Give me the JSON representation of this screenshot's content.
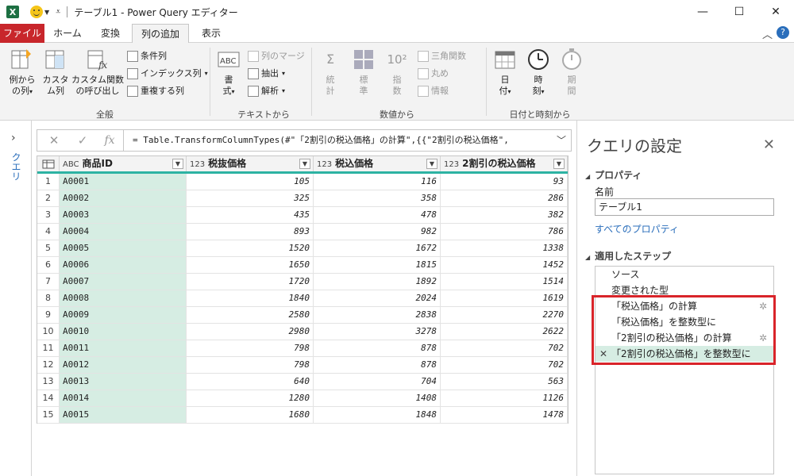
{
  "titlebar": {
    "app_icon": "X",
    "title": "テーブル1 - Power Query エディター",
    "minimize": "—",
    "maximize": "☐",
    "close": "✕"
  },
  "tabs": {
    "items": [
      "ファイル",
      "ホーム",
      "変換",
      "列の追加",
      "表示"
    ],
    "active": "列の追加",
    "collapse": "︿",
    "help": "?"
  },
  "ribbon": {
    "general": {
      "label": "全般",
      "col_from_examples": "例から\nの列",
      "custom_col": "カスタ\nム列",
      "invoke_custom_fn": "カスタム関数\nの呼び出し",
      "conditional_col": "条件列",
      "index_col": "インデックス列",
      "duplicate_col": "重複する列"
    },
    "text": {
      "label": "テキストから",
      "format": "書\n式",
      "merge_cols": "列のマージ",
      "extract": "抽出",
      "parse": "解析"
    },
    "number": {
      "label": "数値から",
      "statistics": "統\n計",
      "standard": "標\n準",
      "scientific": "指\n数",
      "trig": "三角関数",
      "rounding": "丸め",
      "info": "情報"
    },
    "datetime": {
      "label": "日付と時刻から",
      "date": "日\n付",
      "time": "時\n刻",
      "duration": "期\n間"
    }
  },
  "left_pane": {
    "label": "クエリ"
  },
  "formula_bar": {
    "cancel": "✕",
    "confirm": "✓",
    "fx": "fx",
    "expression": "= Table.TransformColumnTypes(#\"「2割引の税込価格」の計算\",{{\"2割引の税込価格\","
  },
  "table": {
    "columns": [
      {
        "type": "ABC",
        "name": "商品ID"
      },
      {
        "type": "123",
        "name": "税抜価格"
      },
      {
        "type": "123",
        "name": "税込価格"
      },
      {
        "type": "123",
        "name": "2割引の税込価格"
      }
    ],
    "rows": [
      [
        "1",
        "A0001",
        "105",
        "116",
        "93"
      ],
      [
        "2",
        "A0002",
        "325",
        "358",
        "286"
      ],
      [
        "3",
        "A0003",
        "435",
        "478",
        "382"
      ],
      [
        "4",
        "A0004",
        "893",
        "982",
        "786"
      ],
      [
        "5",
        "A0005",
        "1520",
        "1672",
        "1338"
      ],
      [
        "6",
        "A0006",
        "1650",
        "1815",
        "1452"
      ],
      [
        "7",
        "A0007",
        "1720",
        "1892",
        "1514"
      ],
      [
        "8",
        "A0008",
        "1840",
        "2024",
        "1619"
      ],
      [
        "9",
        "A0009",
        "2580",
        "2838",
        "2270"
      ],
      [
        "10",
        "A0010",
        "2980",
        "3278",
        "2622"
      ],
      [
        "11",
        "A0011",
        "798",
        "878",
        "702"
      ],
      [
        "12",
        "A0012",
        "798",
        "878",
        "702"
      ],
      [
        "13",
        "A0013",
        "640",
        "704",
        "563"
      ],
      [
        "14",
        "A0014",
        "1280",
        "1408",
        "1126"
      ],
      [
        "15",
        "A0015",
        "1680",
        "1848",
        "1478"
      ]
    ]
  },
  "settings": {
    "title": "クエリの設定",
    "close": "✕",
    "properties_header": "プロパティ",
    "name_label": "名前",
    "name_value": "テーブル1",
    "all_properties": "すべてのプロパティ",
    "steps_header": "適用したステップ",
    "steps": [
      {
        "label": "ソース",
        "gear": false
      },
      {
        "label": "変更された型",
        "gear": false
      },
      {
        "label": "「税込価格」の計算",
        "gear": true
      },
      {
        "label": "「税込価格」を整数型に",
        "gear": false
      },
      {
        "label": "「2割引の税込価格」の計算",
        "gear": true
      },
      {
        "label": "「2割引の税込価格」を整数型に",
        "gear": false,
        "active": true
      }
    ]
  },
  "colors": {
    "file_tab": "#c8262b",
    "accent": "#2db3a3",
    "selected": "#d6ede3",
    "highlight": "#d9242a",
    "link": "#2a6ebb"
  }
}
